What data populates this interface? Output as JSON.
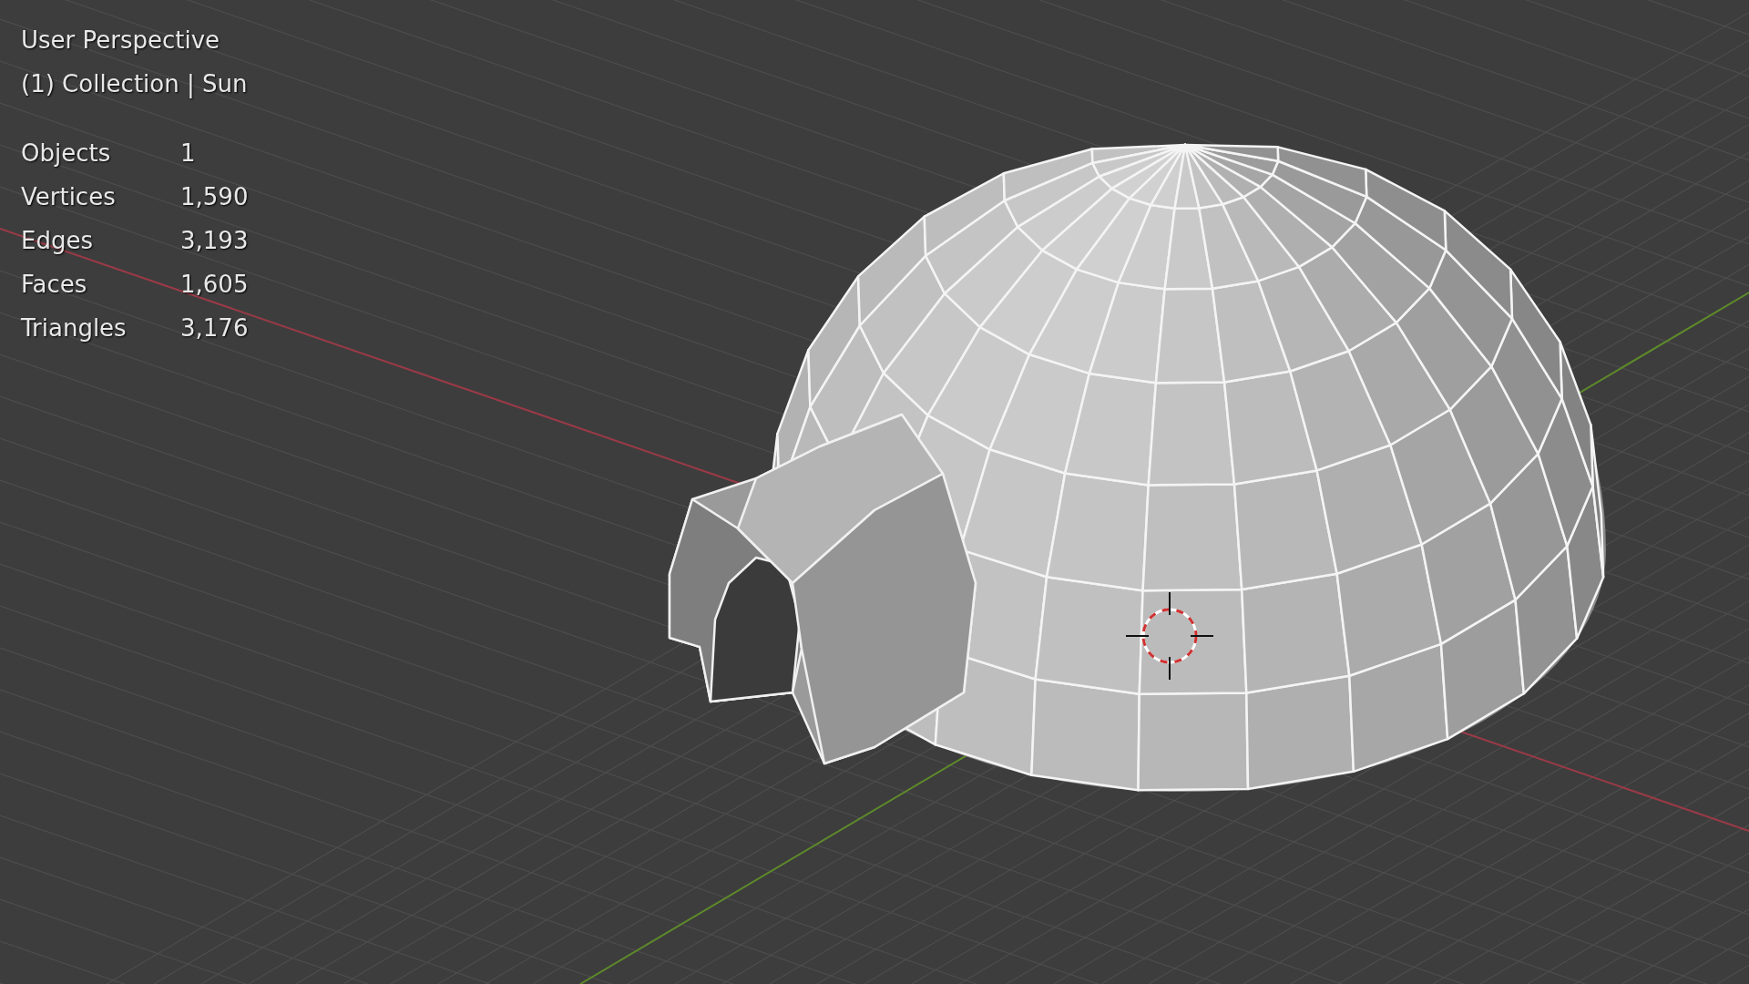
{
  "viewport": {
    "view_name": "User Perspective",
    "context": "(1) Collection | Sun",
    "stats": [
      {
        "label": "Objects",
        "value": "1"
      },
      {
        "label": "Vertices",
        "value": "1,590"
      },
      {
        "label": "Edges",
        "value": "3,193"
      },
      {
        "label": "Faces",
        "value": "1,605"
      },
      {
        "label": "Triangles",
        "value": "3,176"
      }
    ]
  }
}
